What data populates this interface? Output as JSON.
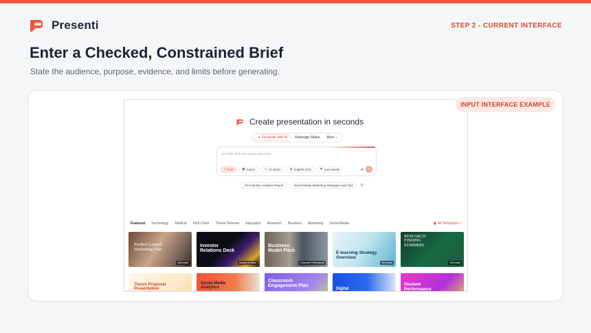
{
  "brand": {
    "name": "Presenti",
    "accent": "#f2553d"
  },
  "header": {
    "step": "STEP 2 - CURRENT INTERFACE"
  },
  "hero": {
    "title": "Enter a Checked, Constrained Brief",
    "subtitle": "State the audience, purpose, evidence, and limits before generating."
  },
  "badge": "INPUT INTERFACE EXAMPLE",
  "app": {
    "title": "Create presentation in seconds",
    "modes": [
      "Generate with AI",
      "Redesign Slides",
      "More"
    ],
    "input_placeholder": "Describe what you want to generate...",
    "tools": {
      "fast": "Fast",
      "expert": "Expert",
      "slides": "15 slides",
      "language": "English (US)",
      "model": "Auto Model",
      "send": "A"
    },
    "suggestions": [
      "Pet Industry Analysis Report",
      "Social Media Marketing Strategies and Tips"
    ],
    "categories": [
      "Featured",
      "Technology",
      "Medical",
      "Pitch Deck",
      "Thesis Defense",
      "Education",
      "Research",
      "Business",
      "Marketing",
      "Social Media"
    ],
    "all_templates": "All Templates >",
    "templates": [
      {
        "title": "Product Launch Marketing Plan",
        "tag": "Minimalist"
      },
      {
        "title": "Investor Relations Deck",
        "tag": "Modern & Sleek"
      },
      {
        "title": "Business Model Pitch",
        "tag": "Corporate Professional"
      },
      {
        "title": "E-learning Strategy Overview",
        "tag": "Minimalist"
      },
      {
        "title": "RESEARCH FINDING SUMMERY",
        "tag": "Minimalist"
      },
      {
        "title": "Thesis Proposal Presentation",
        "tag": ""
      },
      {
        "title": "Social Media Analytics",
        "tag": ""
      },
      {
        "title": "Classroom Engagement Plan",
        "tag": ""
      },
      {
        "title": "Digital",
        "tag": ""
      },
      {
        "title": "Student Performance",
        "tag": ""
      }
    ]
  }
}
